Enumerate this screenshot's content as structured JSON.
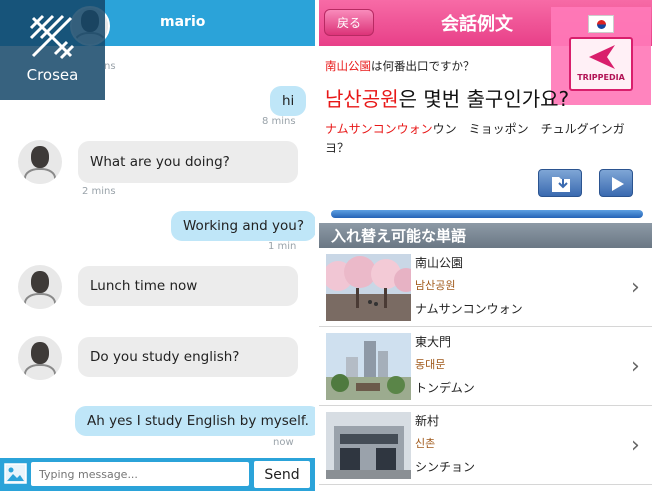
{
  "chat": {
    "title": "mario",
    "logo_text": "Crosea",
    "messages": [
      {
        "direction": "out",
        "text": "hi",
        "time": "8 mins"
      },
      {
        "direction": "in",
        "text": "What are you doing?",
        "time": "2 mins"
      },
      {
        "direction": "out",
        "text": "Working and you?",
        "time": "1 min"
      },
      {
        "direction": "in",
        "text": "Lunch time now",
        "time": ""
      },
      {
        "direction": "in",
        "text": "Do you study english?",
        "time": ""
      },
      {
        "direction": "out",
        "text": "Ah yes I study English by myself.",
        "time": "now"
      }
    ],
    "partial_time": "ns",
    "input_placeholder": "Typing message...",
    "send_label": "Send",
    "accent_color": "#2ba3d9"
  },
  "phrasebook": {
    "back_label": "戻る",
    "title": "会話例文",
    "logo_text": "TRIPPEDIA",
    "question": {
      "highlight": "南山公園",
      "rest": "は何番出口ですか？"
    },
    "korean": {
      "highlight": "남산공원",
      "rest": "은 몇번 출구인가요",
      "mark": "?"
    },
    "kana": {
      "highlight": "ナムサンコンウォン",
      "rest": "ウン　ミョッポン　チュルグインガヨ？"
    },
    "section_title": "入れ替え可能な単語",
    "words": [
      {
        "jp": "南山公園",
        "kr": "남산공원",
        "kana": "ナムサンコンウォン"
      },
      {
        "jp": "東大門",
        "kr": "동대문",
        "kana": "トンデムン"
      },
      {
        "jp": "新村",
        "kr": "신촌",
        "kana": "シンチョン"
      }
    ],
    "accent_color": "#e83f88",
    "icons": [
      "save-folder-icon",
      "play-icon",
      "chevron-right-icon",
      "korea-flag-icon"
    ]
  }
}
